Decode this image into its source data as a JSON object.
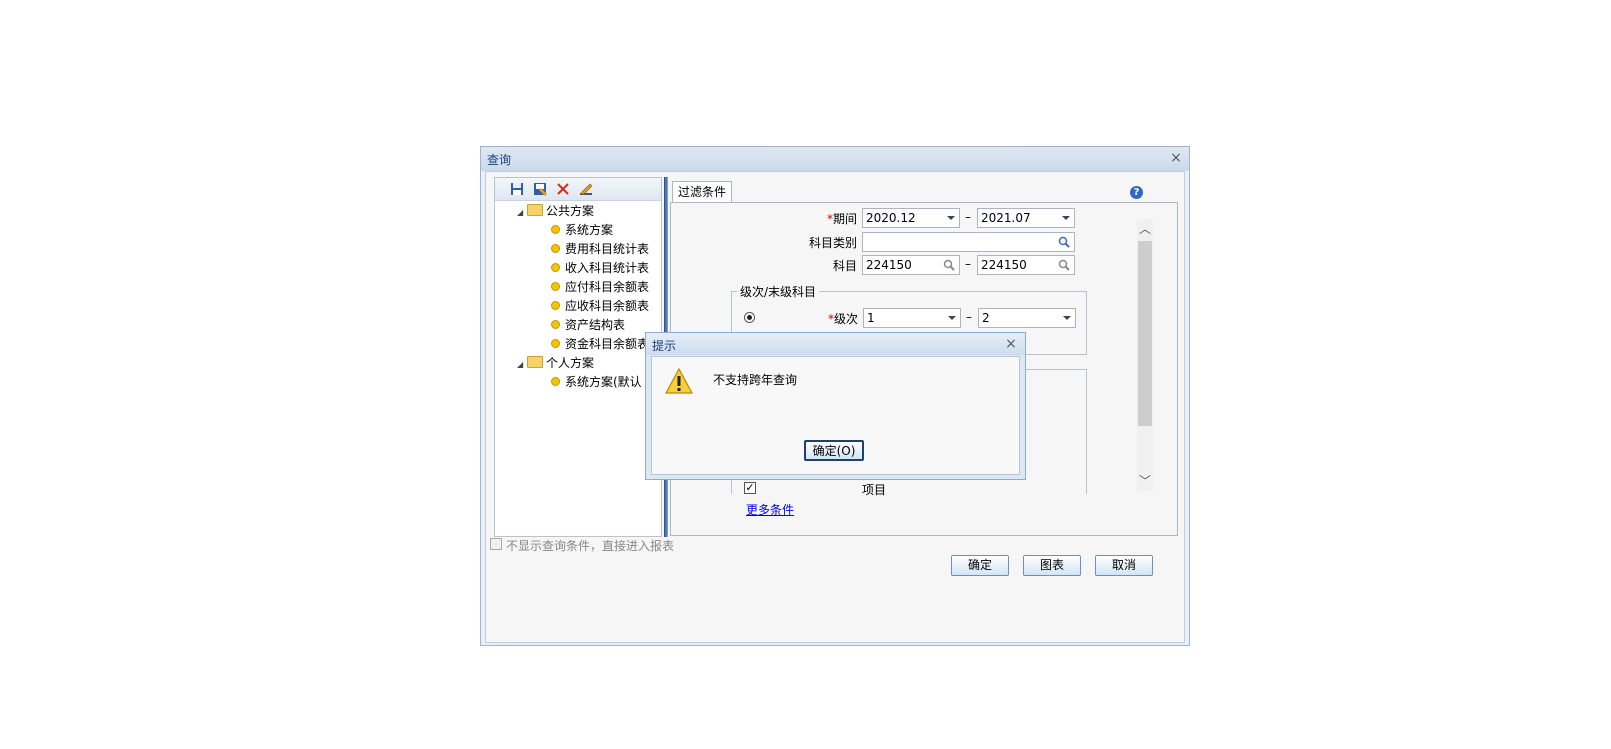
{
  "dialog": {
    "title": "查询",
    "close_glyph": "×",
    "tree": {
      "toolbar": [
        "save-icon",
        "save-as-icon",
        "delete-icon",
        "edit-icon"
      ],
      "groups": [
        {
          "label": "公共方案",
          "items": [
            "系统方案",
            "费用科目统计表",
            "收入科目统计表",
            "应付科目余额表",
            "应收科目余额表",
            "资产结构表",
            "资金科目余额表"
          ]
        },
        {
          "label": "个人方案",
          "items": [
            "系统方案(默认"
          ]
        }
      ]
    },
    "tab_label": "过滤条件",
    "help_glyph": "?",
    "filters": {
      "period_label": "期间",
      "period_from": "2020.12",
      "period_to": "2021.07",
      "category_label": "科目类别",
      "category_value": "",
      "subject_label": "科目",
      "subject_from": "224150",
      "subject_to": "224150",
      "range_dash": "–",
      "required_mark": "*",
      "level_group_title": "级次/末级科目",
      "level_label": "级次",
      "level_from": "1",
      "level_to": "2",
      "project_label": "项目",
      "project_checked": true,
      "check_glyph": "✓",
      "more_link": "更多条件"
    },
    "skip_option_label": "不显示查询条件，直接进入报表",
    "buttons": {
      "ok": "确定",
      "chart": "图表",
      "cancel": "取消"
    }
  },
  "message_box": {
    "title": "提示",
    "close_glyph": "×",
    "icon": "warning-icon",
    "text": "不支持跨年查询",
    "ok_label": "确定(O)"
  }
}
